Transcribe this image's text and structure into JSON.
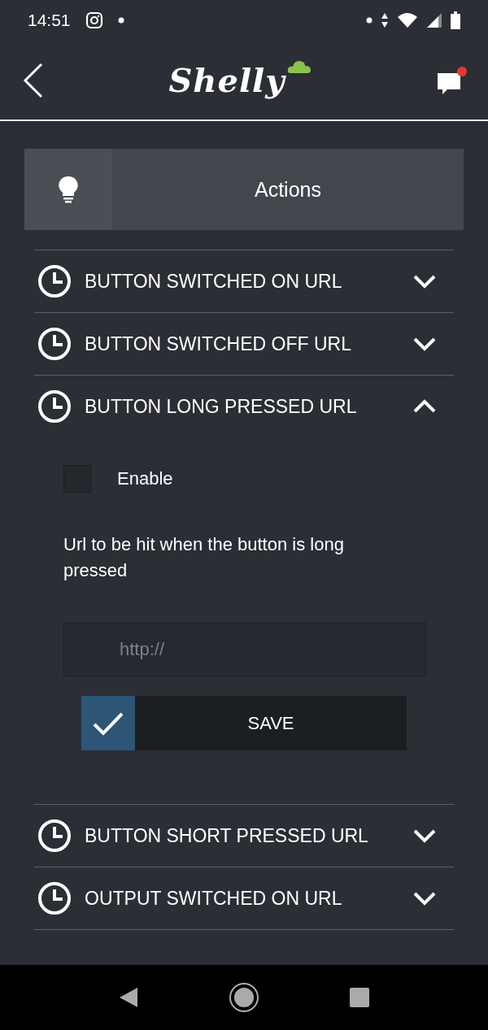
{
  "status_bar": {
    "time": "14:51"
  },
  "header": {
    "logo": "Shelly",
    "notification": true
  },
  "actions_card": {
    "title": "Actions"
  },
  "sections": [
    {
      "title": "BUTTON SWITCHED ON URL",
      "expanded": false
    },
    {
      "title": "BUTTON SWITCHED OFF URL",
      "expanded": false
    },
    {
      "title": "BUTTON LONG PRESSED URL",
      "expanded": true,
      "enable": {
        "label": "Enable",
        "checked": false
      },
      "description": "Url to be hit when the button is long pressed",
      "url_field": {
        "placeholder": "http://"
      },
      "save_button": {
        "label": "SAVE"
      }
    },
    {
      "title": "BUTTON SHORT PRESSED URL",
      "expanded": false
    },
    {
      "title": "OUTPUT SWITCHED ON URL",
      "expanded": false
    }
  ]
}
